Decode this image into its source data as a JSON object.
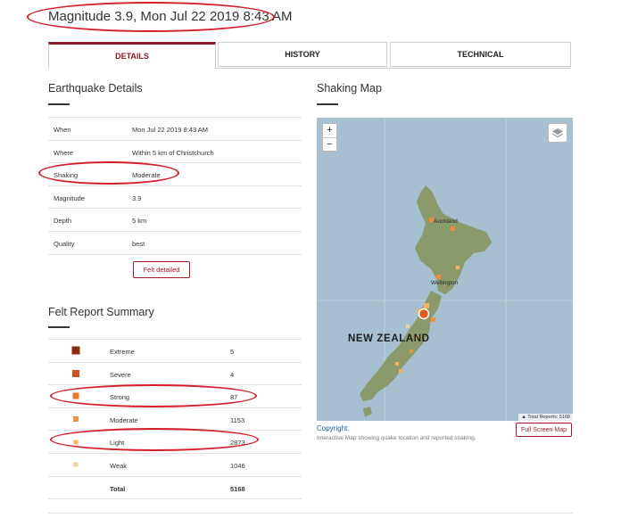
{
  "page": {
    "title": "Magnitude 3.9, Mon Jul 22 2019 8:43 AM"
  },
  "tabs": [
    {
      "label": "DETAILS"
    },
    {
      "label": "HISTORY"
    },
    {
      "label": "TECHNICAL"
    }
  ],
  "details": {
    "heading": "Earthquake Details",
    "rows": [
      {
        "key": "When",
        "value": "Mon Jul 22 2019 8:43 AM"
      },
      {
        "key": "Where",
        "value": "Within 5 km of Christchurch"
      },
      {
        "key": "Shaking",
        "value": "Moderate"
      },
      {
        "key": "Magnitude",
        "value": "3.9"
      },
      {
        "key": "Depth",
        "value": "5 km"
      },
      {
        "key": "Quality",
        "value": "best"
      }
    ],
    "felt_button": "Felt detailed"
  },
  "felt": {
    "heading": "Felt Report Summary",
    "rows": [
      {
        "label": "Extreme",
        "count": "5",
        "color": "#8a2b10"
      },
      {
        "label": "Severe",
        "count": "4",
        "color": "#d2501e"
      },
      {
        "label": "Strong",
        "count": "87",
        "color": "#e8772e"
      },
      {
        "label": "Moderate",
        "count": "1153",
        "color": "#f0953f"
      },
      {
        "label": "Light",
        "count": "2873",
        "color": "#f5b060"
      },
      {
        "label": "Weak",
        "count": "1046",
        "color": "#f8cf97"
      }
    ],
    "total": {
      "label": "Total",
      "count": "5168"
    }
  },
  "map": {
    "heading": "Shaking Map",
    "zoom_in": "+",
    "zoom_out": "−",
    "country_label": "NEW ZEALAND",
    "city_auckland": "Auckland",
    "city_wellington": "Wellington",
    "attribution": "Total Reports: 5168",
    "copyright": "Copyright.",
    "caption": "Interactive Map showing quake location and reported shaking.",
    "fullscreen": "Full Screen Map",
    "colors": {
      "sea": "#a6bfd1",
      "land": "#8a9a6a",
      "marker": "#ef8b3a",
      "epicentre": "#e05a1e"
    }
  },
  "annotation": {
    "color": "#d21f2b"
  }
}
